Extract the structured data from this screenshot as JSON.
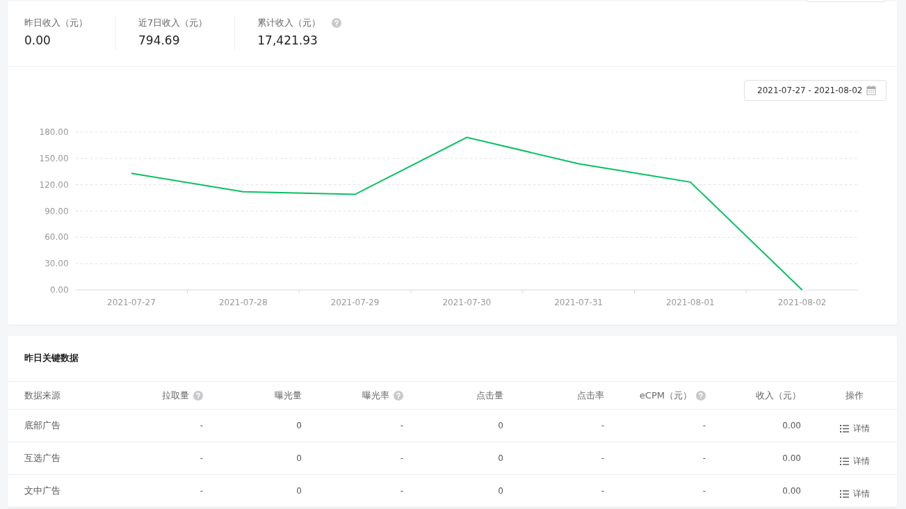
{
  "stats": [
    {
      "label": "昨日收入（元）",
      "value": "0.00",
      "help": false
    },
    {
      "label": "近7日收入（元）",
      "value": "794.69",
      "help": false
    },
    {
      "label": "累计收入（元）",
      "value": "17,421.93",
      "help": true
    }
  ],
  "date_range": {
    "value": "2021-07-27 - 2021-08-02"
  },
  "chart_data": {
    "type": "line",
    "categories": [
      "2021-07-27",
      "2021-07-28",
      "2021-07-29",
      "2021-07-30",
      "2021-07-31",
      "2021-08-01",
      "2021-08-02"
    ],
    "series": [
      {
        "color": "#07c160",
        "values": [
          133,
          112,
          109,
          174,
          144,
          123,
          0
        ]
      }
    ],
    "grid": true,
    "ylim": [
      0,
      180
    ],
    "yticks": [
      {
        "value": 0,
        "label": "0.00"
      },
      {
        "value": 30,
        "label": "30.00"
      },
      {
        "value": 60,
        "label": "60.00"
      },
      {
        "value": 90,
        "label": "90.00"
      },
      {
        "value": 120,
        "label": "120.00"
      },
      {
        "value": 150,
        "label": "150.00"
      },
      {
        "value": 180,
        "label": "180.00"
      }
    ]
  },
  "key_data": {
    "title": "昨日关键数据",
    "columns": [
      {
        "label": "数据来源",
        "help": false
      },
      {
        "label": "拉取量",
        "help": true
      },
      {
        "label": "曝光量",
        "help": false
      },
      {
        "label": "曝光率",
        "help": true
      },
      {
        "label": "点击量",
        "help": false
      },
      {
        "label": "点击率",
        "help": false
      },
      {
        "label": "eCPM（元）",
        "help": true
      },
      {
        "label": "收入（元）",
        "help": false
      },
      {
        "label": "操作",
        "help": false
      }
    ],
    "rows": [
      {
        "cells": [
          "底部广告",
          "-",
          "0",
          "-",
          "0",
          "-",
          "-",
          "0.00"
        ],
        "action": "详情"
      },
      {
        "cells": [
          "互选广告",
          "-",
          "0",
          "-",
          "0",
          "-",
          "-",
          "0.00"
        ],
        "action": "详情"
      },
      {
        "cells": [
          "文中广告",
          "-",
          "0",
          "-",
          "0",
          "-",
          "-",
          "0.00"
        ],
        "action": "详情"
      }
    ]
  }
}
